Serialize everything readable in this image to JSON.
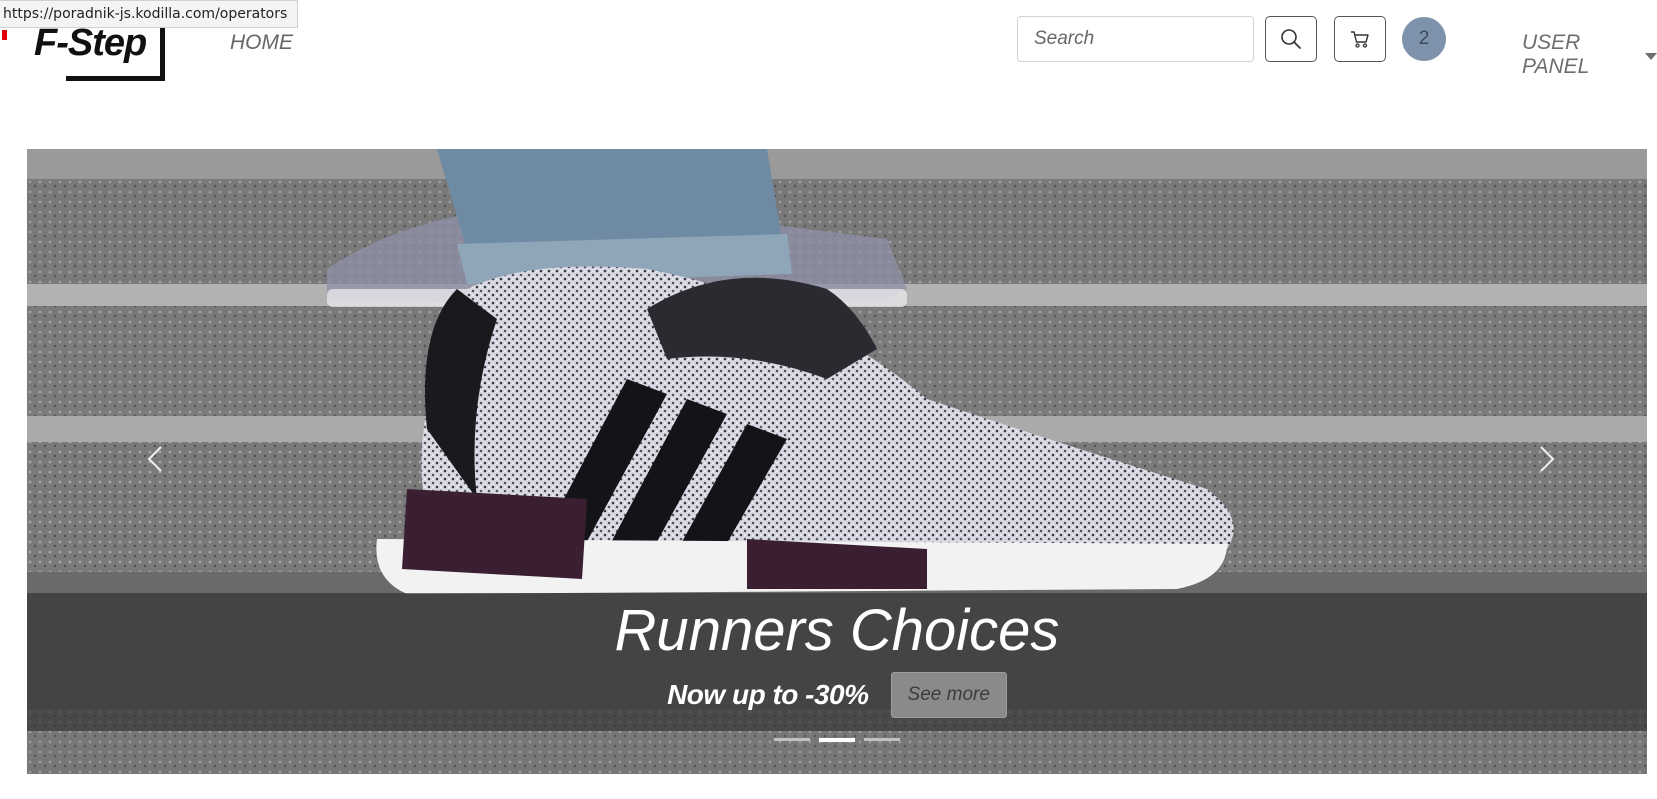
{
  "status_url": "https://poradnik-js.kodilla.com/operators",
  "brand": {
    "logo_text": "F-Step"
  },
  "nav": {
    "home_label": "HOME"
  },
  "search": {
    "placeholder": "Search"
  },
  "cart": {
    "count": "2"
  },
  "user_menu": {
    "label": "USER PANEL"
  },
  "carousel": {
    "title": "Runners Choices",
    "subtitle": "Now up to -30%",
    "button_label": "See more",
    "slide_count": 3,
    "active_slide": 2
  },
  "icons": [
    "search-icon",
    "cart-icon",
    "chevron-left-icon",
    "chevron-right-icon",
    "caret-down-icon"
  ],
  "colors": {
    "badge": "#7f92ab",
    "caption_band": "#2d2d2d",
    "text_muted": "#666666"
  }
}
